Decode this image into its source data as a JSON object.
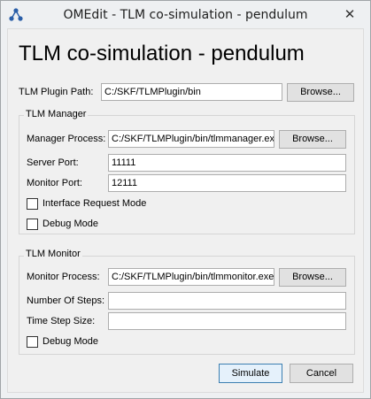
{
  "window": {
    "title": "OMEdit - TLM co-simulation - pendulum",
    "close_glyph": "✕",
    "app_icon": "omedit-logo"
  },
  "dialog": {
    "heading": "TLM co-simulation - pendulum",
    "plugin_path": {
      "label": "TLM Plugin Path:",
      "value": "C:/SKF/TLMPlugin/bin",
      "browse_label": "Browse..."
    },
    "manager": {
      "title": "TLM Manager",
      "process_label": "Manager Process:",
      "process_value": "C:/SKF/TLMPlugin/bin/tlmmanager.exe",
      "browse_label": "Browse...",
      "server_port_label": "Server Port:",
      "server_port_value": "11111",
      "monitor_port_label": "Monitor Port:",
      "monitor_port_value": "12111",
      "interface_request_label": "Interface Request Mode",
      "interface_request_checked": false,
      "debug_label": "Debug Mode",
      "debug_checked": false
    },
    "monitor": {
      "title": "TLM Monitor",
      "process_label": "Monitor Process:",
      "process_value": "C:/SKF/TLMPlugin/bin/tlmmonitor.exe",
      "browse_label": "Browse...",
      "steps_label": "Number Of Steps:",
      "steps_value": "",
      "time_step_label": "Time Step Size:",
      "time_step_value": "",
      "debug_label": "Debug Mode",
      "debug_checked": false
    },
    "buttons": {
      "simulate_label": "Simulate",
      "cancel_label": "Cancel"
    }
  }
}
